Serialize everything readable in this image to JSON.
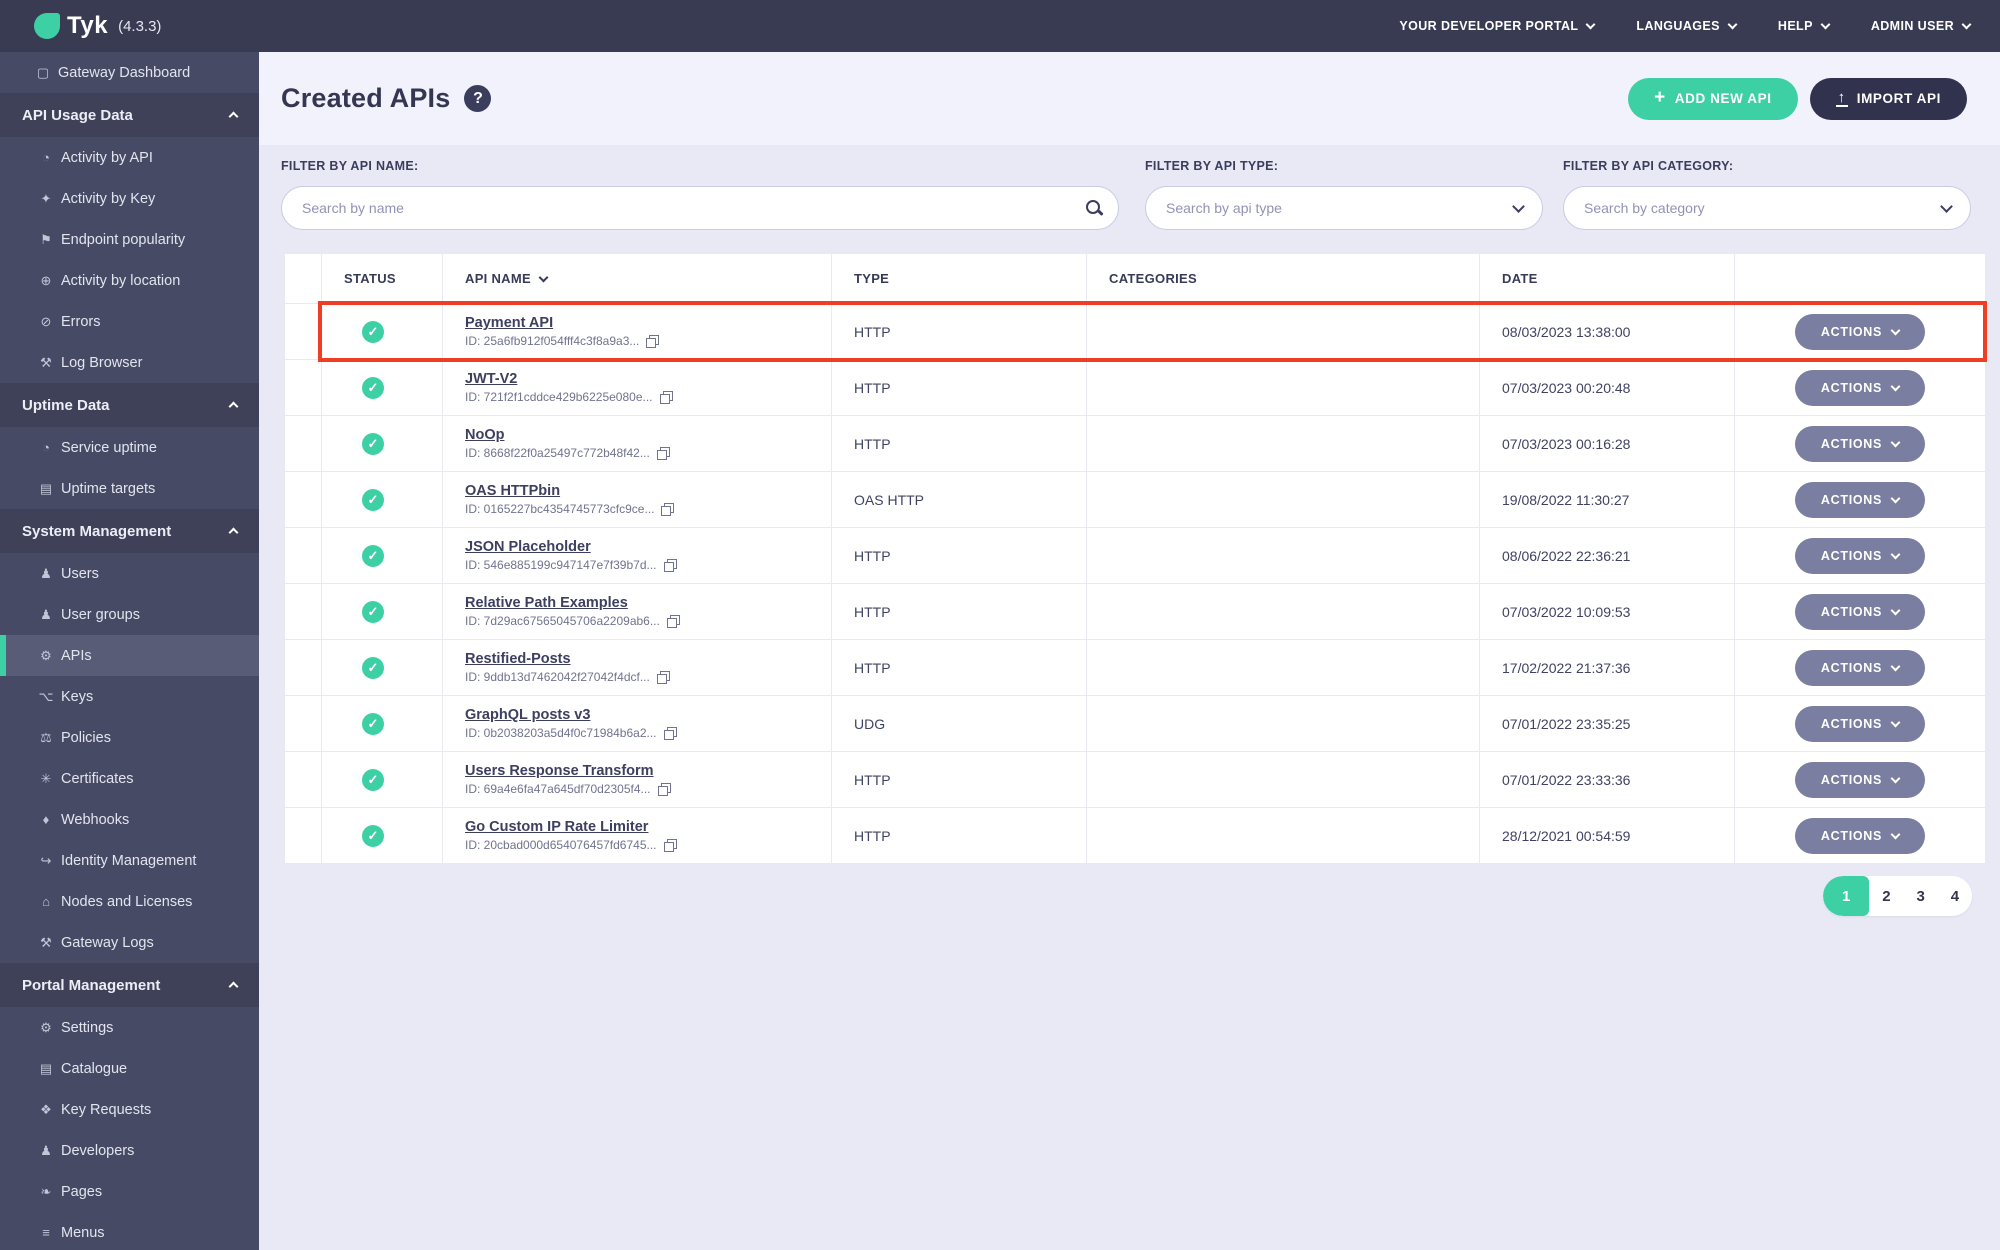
{
  "colors": {
    "accent_teal": "#3ed0a5",
    "navy": "#31334e",
    "topbar_bg": "#383b52",
    "sidebar_bg": "#474a64",
    "actions_grey": "#7a7ea0",
    "highlight_red": "#ee3f25",
    "page_bg": "#e8e9f5"
  },
  "topbar": {
    "logo_text": "Tyk",
    "version": "(4.3.3)",
    "menu": [
      {
        "label": "YOUR DEVELOPER PORTAL"
      },
      {
        "label": "LANGUAGES"
      },
      {
        "label": "HELP"
      },
      {
        "label": "ADMIN USER"
      }
    ]
  },
  "icon_glyphs": {
    "monitor-icon": "▢",
    "gauge-icon": "◔",
    "key-icon": "✦",
    "branch-icon": "⚑",
    "globe-icon": "⊕",
    "errors-icon": "⊘",
    "bug-icon": "⚒",
    "uptime-icon": "◔",
    "list-icon": "▤",
    "user-icon": "♟",
    "users-icon": "♟",
    "gears-icon": "⚙",
    "network-icon": "⌥",
    "policies-icon": "⚖",
    "certificate-icon": "✳",
    "bell-icon": "♦",
    "identity-icon": "↪",
    "building-icon": "⌂",
    "wrench-icon": "⚙",
    "paw-icon": "❖",
    "leaf-icon": "❧",
    "menu-icon": "≡"
  },
  "sidebar": {
    "sections": [
      {
        "header": null,
        "items": [
          {
            "label": "Gateway Dashboard",
            "icon": "monitor-icon"
          }
        ]
      },
      {
        "header": "API Usage Data",
        "items": [
          {
            "label": "Activity by API",
            "icon": "gauge-icon"
          },
          {
            "label": "Activity by Key",
            "icon": "key-icon"
          },
          {
            "label": "Endpoint popularity",
            "icon": "branch-icon"
          },
          {
            "label": "Activity by location",
            "icon": "globe-icon"
          },
          {
            "label": "Errors",
            "icon": "errors-icon"
          },
          {
            "label": "Log Browser",
            "icon": "bug-icon"
          }
        ]
      },
      {
        "header": "Uptime Data",
        "items": [
          {
            "label": "Service uptime",
            "icon": "uptime-icon"
          },
          {
            "label": "Uptime targets",
            "icon": "list-icon"
          }
        ]
      },
      {
        "header": "System Management",
        "items": [
          {
            "label": "Users",
            "icon": "user-icon"
          },
          {
            "label": "User groups",
            "icon": "users-icon"
          },
          {
            "label": "APIs",
            "icon": "gears-icon",
            "active": true
          },
          {
            "label": "Keys",
            "icon": "network-icon"
          },
          {
            "label": "Policies",
            "icon": "policies-icon"
          },
          {
            "label": "Certificates",
            "icon": "certificate-icon"
          },
          {
            "label": "Webhooks",
            "icon": "bell-icon"
          },
          {
            "label": "Identity Management",
            "icon": "identity-icon"
          },
          {
            "label": "Nodes and Licenses",
            "icon": "building-icon"
          },
          {
            "label": "Gateway Logs",
            "icon": "bug-icon"
          }
        ]
      },
      {
        "header": "Portal Management",
        "items": [
          {
            "label": "Settings",
            "icon": "wrench-icon"
          },
          {
            "label": "Catalogue",
            "icon": "list-icon"
          },
          {
            "label": "Key Requests",
            "icon": "paw-icon"
          },
          {
            "label": "Developers",
            "icon": "users-icon"
          },
          {
            "label": "Pages",
            "icon": "leaf-icon"
          },
          {
            "label": "Menus",
            "icon": "menu-icon"
          }
        ]
      }
    ]
  },
  "page": {
    "title": "Created APIs",
    "help_glyph": "?",
    "add_button_label": "ADD NEW API",
    "import_button_label": "IMPORT API"
  },
  "filters": {
    "name": {
      "label": "FILTER BY API NAME:",
      "placeholder": "Search by name"
    },
    "type": {
      "label": "FILTER BY API TYPE:",
      "placeholder": "Search by api type"
    },
    "category": {
      "label": "FILTER BY API CATEGORY:",
      "placeholder": "Search by category"
    }
  },
  "table": {
    "columns": [
      "",
      "STATUS",
      "API NAME",
      "TYPE",
      "CATEGORIES",
      "DATE",
      ""
    ],
    "actions_label": "ACTIONS",
    "rows": [
      {
        "status": "active",
        "name": "Payment API",
        "id": "ID: 25a6fb912f054fff4c3f8a9a3...",
        "type": "HTTP",
        "categories": "",
        "date": "08/03/2023 13:38:00",
        "highlighted": true
      },
      {
        "status": "active",
        "name": "JWT-V2",
        "id": "ID: 721f2f1cddce429b6225e080e...",
        "type": "HTTP",
        "categories": "",
        "date": "07/03/2023 00:20:48"
      },
      {
        "status": "active",
        "name": "NoOp",
        "id": "ID: 8668f22f0a25497c772b48f42...",
        "type": "HTTP",
        "categories": "",
        "date": "07/03/2023 00:16:28"
      },
      {
        "status": "active",
        "name": "OAS HTTPbin",
        "id": "ID: 0165227bc4354745773cfc9ce...",
        "type": "OAS HTTP",
        "categories": "",
        "date": "19/08/2022 11:30:27"
      },
      {
        "status": "active",
        "name": "JSON Placeholder",
        "id": "ID: 546e885199c947147e7f39b7d...",
        "type": "HTTP",
        "categories": "",
        "date": "08/06/2022 22:36:21"
      },
      {
        "status": "active",
        "name": "Relative Path Examples",
        "id": "ID: 7d29ac67565045706a2209ab6...",
        "type": "HTTP",
        "categories": "",
        "date": "07/03/2022 10:09:53"
      },
      {
        "status": "active",
        "name": "Restified-Posts",
        "id": "ID: 9ddb13d7462042f27042f4dcf...",
        "type": "HTTP",
        "categories": "",
        "date": "17/02/2022 21:37:36"
      },
      {
        "status": "active",
        "name": "GraphQL posts v3",
        "id": "ID: 0b2038203a5d4f0c71984b6a2...",
        "type": "UDG",
        "categories": "",
        "date": "07/01/2022 23:35:25"
      },
      {
        "status": "active",
        "name": "Users Response Transform",
        "id": "ID: 69a4e6fa47a645df70d2305f4...",
        "type": "HTTP",
        "categories": "",
        "date": "07/01/2022 23:33:36"
      },
      {
        "status": "active",
        "name": "Go Custom IP Rate Limiter",
        "id": "ID: 20cbad000d654076457fd6745...",
        "type": "HTTP",
        "categories": "",
        "date": "28/12/2021 00:54:59"
      }
    ]
  },
  "pagination": {
    "pages": [
      "1",
      "2",
      "3",
      "4"
    ],
    "active": "1"
  }
}
